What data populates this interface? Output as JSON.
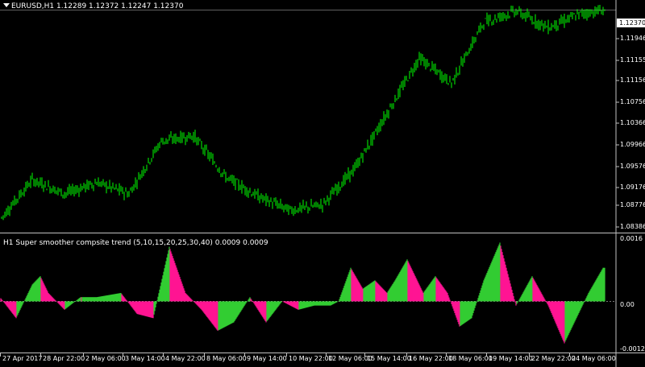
{
  "main_chart": {
    "symbol_line": "EURUSD,H1  1.12289 1.12372 1.12247 1.12370",
    "current_price": "1.12370",
    "price_ticks": [
      "1.11946",
      "1.11155",
      "1.11156",
      "1.10756",
      "1.10366",
      "1.09966",
      "1.09576",
      "1.09176",
      "1.08776",
      "1.08386"
    ],
    "colors": {
      "candles": "#00ff00",
      "grid": "#c0c0c0",
      "background": "#000000"
    }
  },
  "indicator": {
    "title": "H1 Super smoother compsite trend (5,10,15,20,25,30,40) 0.0009 0.0009",
    "ticks": [
      "0.0016",
      "0.00",
      "-0.0012"
    ],
    "colors": {
      "up": "#32cd32",
      "down": "#ff1493"
    }
  },
  "x_axis": {
    "labels": [
      "27 Apr 2017",
      "28 Apr 22:00",
      "2 May 06:00",
      "3 May 14:00",
      "4 May 22:00",
      "8 May 06:00",
      "9 May 14:00",
      "10 May 22:00",
      "12 May 06:00",
      "15 May 14:00",
      "16 May 22:00",
      "18 May 06:00",
      "19 May 14:00",
      "22 May 22:00",
      "24 May 06:00"
    ]
  },
  "chart_data": [
    {
      "type": "line",
      "title": "EURUSD,H1",
      "series": [
        {
          "name": "EURUSD",
          "x": [
            0,
            40,
            80,
            120,
            160,
            200,
            240,
            280,
            320,
            360,
            400,
            440,
            480,
            520,
            560,
            600,
            640,
            680,
            720,
            750
          ],
          "values": [
            1.0858,
            1.093,
            1.0905,
            1.0925,
            1.0905,
            1.1,
            1.101,
            1.0935,
            1.09,
            1.0875,
            1.0885,
            1.095,
            1.105,
            1.115,
            1.1105,
            1.1215,
            1.1235,
            1.1205,
            1.123,
            1.1237
          ]
        }
      ],
      "ylim": [
        1.0836,
        1.1255
      ]
    },
    {
      "type": "area",
      "title": "H1 Super smoother compsite trend (5,10,15,20,25,30,40) 0.0009 0.0009",
      "series": [
        {
          "name": "composite trend",
          "x": [
            0,
            20,
            40,
            50,
            60,
            80,
            100,
            120,
            150,
            170,
            190,
            210,
            230,
            250,
            270,
            290,
            310,
            330,
            350,
            370,
            390,
            410,
            420,
            435,
            450,
            465,
            480,
            490,
            505,
            525,
            540,
            555,
            570,
            585,
            600,
            620,
            640,
            660,
            680,
            700,
            715,
            730,
            748
          ],
          "values": [
            0.0001,
            -0.0004,
            0.0004,
            0.0006,
            0.0002,
            -0.0002,
            0.0001,
            0.0001,
            0.0002,
            -0.0003,
            -0.0004,
            0.0013,
            0.0002,
            -0.0002,
            -0.0007,
            -0.0005,
            0.0001,
            -0.0005,
            0.0,
            -0.0002,
            -0.0001,
            -0.0001,
            0.0,
            0.0008,
            0.0003,
            0.0005,
            0.0002,
            0.0005,
            0.001,
            0.0002,
            0.0006,
            0.0002,
            -0.0006,
            -0.0004,
            0.0005,
            0.0014,
            -0.0001,
            0.0006,
            -0.0001,
            -0.001,
            -0.0004,
            0.0002,
            0.0008
          ]
        }
      ],
      "ylim": [
        -0.0012,
        0.0016
      ]
    }
  ]
}
